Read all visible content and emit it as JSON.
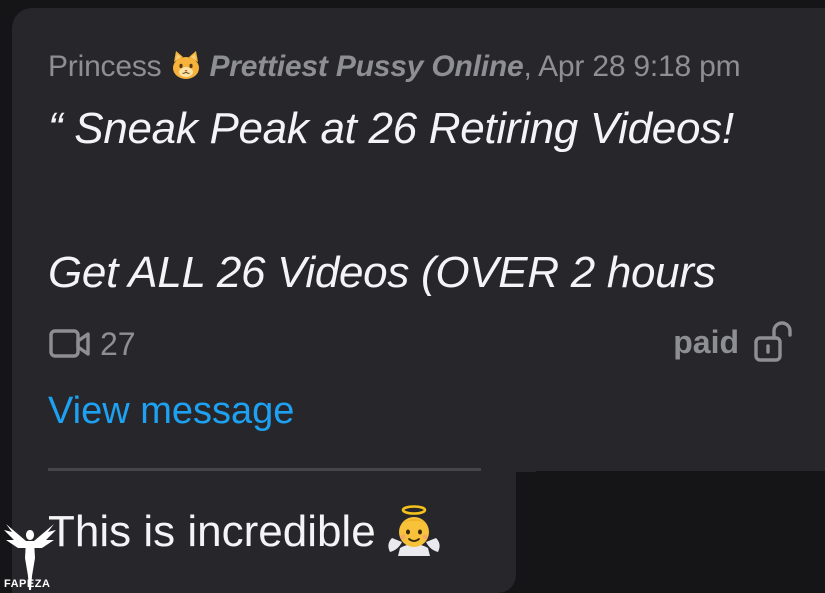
{
  "message": {
    "sender_name": "Princess",
    "sender_emoji_icon": "cat-face-icon",
    "group_name": "Prettiest Pussy Online",
    "timestamp_separator": ",",
    "timestamp": "Apr 28 9:18 pm",
    "quote_line1": "“ Sneak Peak at 26 Retiring Videos!",
    "quote_line2": "Get ALL 26 Videos (OVER 2 hours",
    "video_icon": "video-camera-icon",
    "video_count": "27",
    "paid_label": "paid",
    "paid_icon": "unlocked-padlock-icon",
    "view_message_label": "View message"
  },
  "reply": {
    "text": "This is incredible",
    "emoji_icon": "baby-angel-icon"
  },
  "watermark": {
    "text": "FAPEZA"
  },
  "colors": {
    "background": "#151518",
    "card": "#27272b",
    "muted_text": "#8e8e95",
    "primary_text": "#f4f4f6",
    "link": "#1da1f2"
  }
}
